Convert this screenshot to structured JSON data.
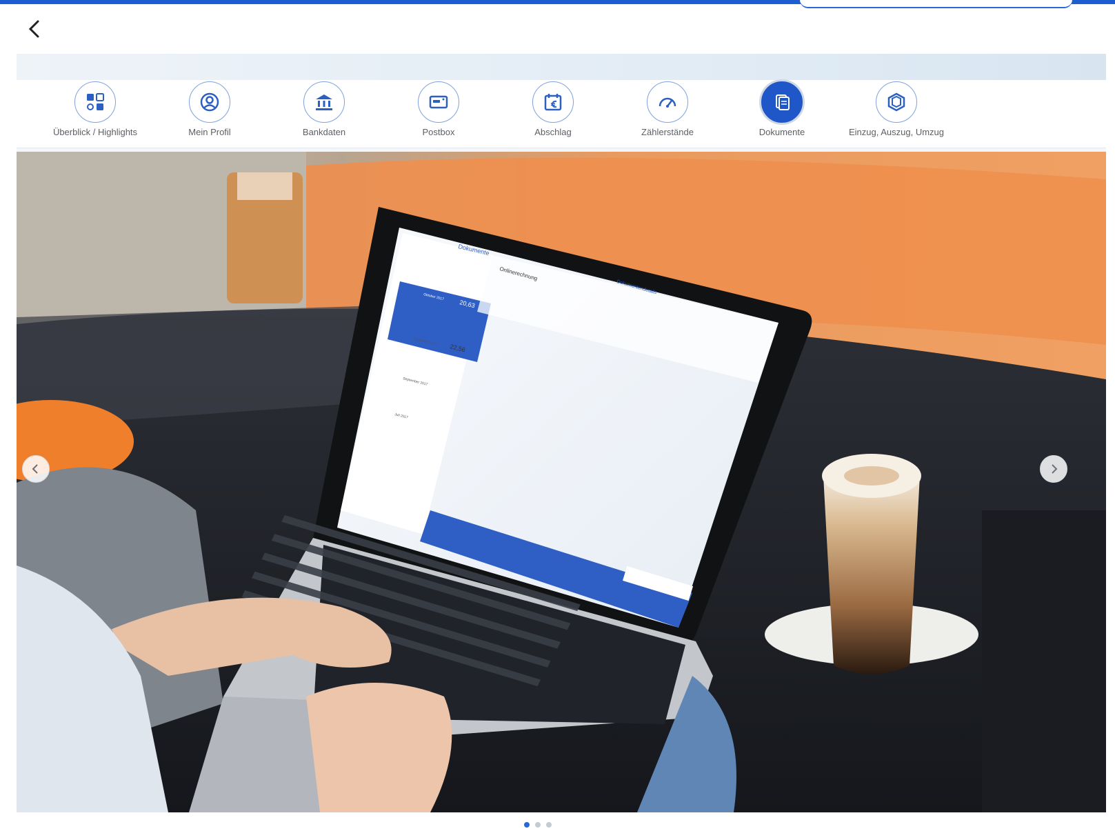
{
  "header": {
    "back_icon": "chevron-left-icon"
  },
  "nav": {
    "items": [
      {
        "label": "Überblick / Highlights",
        "icon": "dashboard-icon",
        "active": false
      },
      {
        "label": "Mein Profil",
        "icon": "user-icon",
        "active": false
      },
      {
        "label": "Bankdaten",
        "icon": "bank-icon",
        "active": false
      },
      {
        "label": "Postbox",
        "icon": "mailbox-icon",
        "active": false
      },
      {
        "label": "Abschlag",
        "icon": "calendar-euro-icon",
        "active": false
      },
      {
        "label": "Zählerstände",
        "icon": "gauge-icon",
        "active": false
      },
      {
        "label": "Dokumente",
        "icon": "documents-icon",
        "active": true
      },
      {
        "label": "Einzug, Auszug, Umzug",
        "icon": "box-icon",
        "active": false
      }
    ]
  },
  "carousel": {
    "prev_icon": "chevron-left-icon",
    "next_icon": "chevron-right-icon",
    "slides": 3,
    "active_slide": 1
  },
  "laptop_screen": {
    "title": "Dokumente",
    "detail_heading": "Dokumentendetails",
    "doc_type": "Onlinerechnung",
    "list": [
      {
        "label": "Oktober 2017",
        "amount": "20,63"
      },
      {
        "label": "September 2017",
        "amount": "22,56"
      },
      {
        "label": "September 2017",
        "amount": ""
      },
      {
        "label": "Juli 2017",
        "amount": ""
      }
    ]
  },
  "colors": {
    "accent": "#1f56c8",
    "topline": "#1d5fd1",
    "nav_label": "#5b5f66"
  }
}
